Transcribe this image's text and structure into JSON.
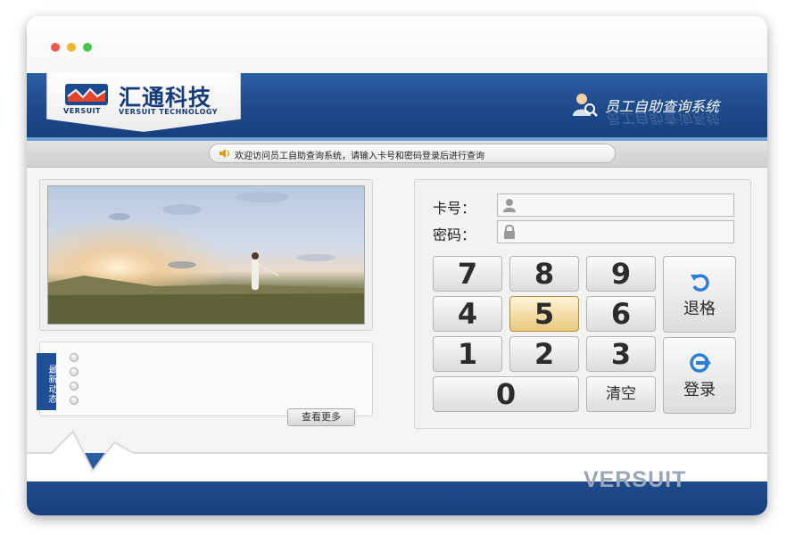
{
  "brand": {
    "name_cn": "汇通科技",
    "name_en": "VERSUIT TECHNOLOGY",
    "mark_text": "VERSUIT",
    "footer_logo": "VERSUIT"
  },
  "header": {
    "system_title": "员工自助查询系统"
  },
  "notice": {
    "text": "欢迎访问员工自助查询系统，请输入卡号和密码登录后进行查询"
  },
  "news": {
    "tag": "最新动态",
    "more_label": "查看更多"
  },
  "login": {
    "card_label": "卡号：",
    "password_label": "密码：",
    "card_value": "",
    "password_value": ""
  },
  "keypad": {
    "keys": [
      "7",
      "8",
      "9",
      "4",
      "5",
      "6",
      "1",
      "2",
      "3",
      "0"
    ],
    "active_key": "5",
    "clear_label": "清空",
    "backspace_label": "退格",
    "login_label": "登录"
  },
  "colors": {
    "header_blue": "#1e4a8c",
    "accent_blue": "#2c5fa3",
    "active_key": "#e8c97d"
  },
  "icons": {
    "card": "user-icon",
    "password": "lock-icon",
    "backspace": "undo-arrow-icon",
    "login": "login-arrow-icon",
    "notice": "speaker-icon",
    "system": "user-search-icon"
  }
}
